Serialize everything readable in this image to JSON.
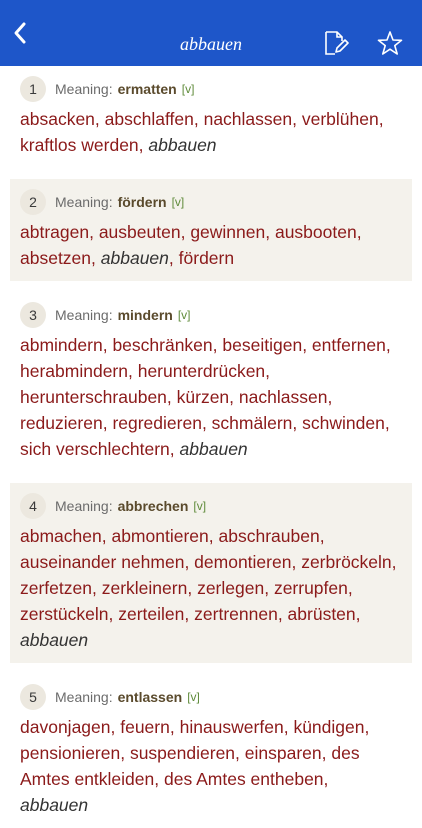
{
  "nav": {
    "title": "abbauen",
    "accent": "#1e56c9",
    "back_icon": "chevron-left-icon",
    "edit_icon": "edit-note-icon",
    "star_icon": "star-outline-icon"
  },
  "senses": [
    {
      "number": "1",
      "label": "Meaning:",
      "word": "ermatten",
      "pos": "[v]",
      "synonyms": [
        {
          "t": "absacken"
        },
        {
          "t": "abschlaffen"
        },
        {
          "t": "nachlassen"
        },
        {
          "t": "verblühen"
        },
        {
          "t": "kraftlos werden"
        },
        {
          "t": "abbauen",
          "i": true
        }
      ]
    },
    {
      "number": "2",
      "label": "Meaning:",
      "word": "fördern",
      "pos": "[v]",
      "synonyms": [
        {
          "t": "abtragen"
        },
        {
          "t": "ausbeuten"
        },
        {
          "t": "gewinnen"
        },
        {
          "t": "ausbooten"
        },
        {
          "t": "absetzen"
        },
        {
          "t": "abbauen",
          "i": true
        },
        {
          "t": "fördern"
        }
      ]
    },
    {
      "number": "3",
      "label": "Meaning:",
      "word": "mindern",
      "pos": "[v]",
      "synonyms": [
        {
          "t": "abmindern"
        },
        {
          "t": "beschränken"
        },
        {
          "t": "beseitigen"
        },
        {
          "t": "entfernen"
        },
        {
          "t": "herabmindern"
        },
        {
          "t": "herunterdrücken"
        },
        {
          "t": "herunterschrauben"
        },
        {
          "t": "kürzen"
        },
        {
          "t": "nachlassen"
        },
        {
          "t": "reduzieren"
        },
        {
          "t": "regredieren"
        },
        {
          "t": "schmälern"
        },
        {
          "t": "schwinden"
        },
        {
          "t": "sich verschlechtern"
        },
        {
          "t": "abbauen",
          "i": true
        }
      ]
    },
    {
      "number": "4",
      "label": "Meaning:",
      "word": "abbrechen",
      "pos": "[v]",
      "synonyms": [
        {
          "t": "abmachen"
        },
        {
          "t": "abmontieren"
        },
        {
          "t": "abschrauben"
        },
        {
          "t": "auseinander nehmen"
        },
        {
          "t": "demontieren"
        },
        {
          "t": "zerbröckeln"
        },
        {
          "t": "zerfetzen"
        },
        {
          "t": "zerkleinern"
        },
        {
          "t": "zerlegen"
        },
        {
          "t": "zerrupfen"
        },
        {
          "t": "zerstückeln"
        },
        {
          "t": "zerteilen"
        },
        {
          "t": "zertrennen"
        },
        {
          "t": "abrüsten"
        },
        {
          "t": "abbauen",
          "i": true
        }
      ]
    },
    {
      "number": "5",
      "label": "Meaning:",
      "word": "entlassen",
      "pos": "[v]",
      "synonyms": [
        {
          "t": "davonjagen"
        },
        {
          "t": "feuern"
        },
        {
          "t": "hinauswerfen"
        },
        {
          "t": "kündigen"
        },
        {
          "t": "pensionieren"
        },
        {
          "t": "suspendieren"
        },
        {
          "t": "einsparen"
        },
        {
          "t": "des Amtes entkleiden"
        },
        {
          "t": "des Amtes entheben"
        },
        {
          "t": "abbauen",
          "i": true
        }
      ]
    }
  ]
}
